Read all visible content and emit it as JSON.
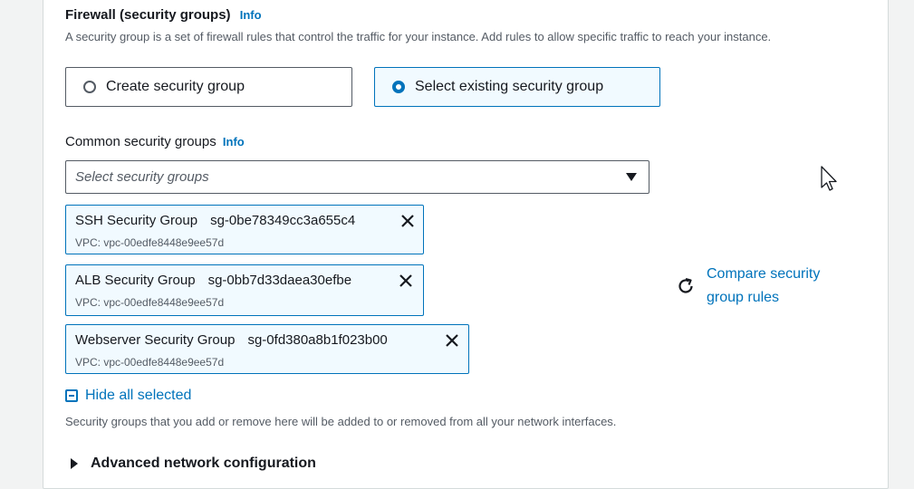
{
  "firewall": {
    "title": "Firewall (security groups)",
    "info": "Info",
    "description": "A security group is a set of firewall rules that control the traffic for your instance. Add rules to allow specific traffic to reach your instance."
  },
  "options": {
    "create_label": "Create security group",
    "existing_label": "Select existing security group",
    "selected": "existing"
  },
  "common_groups": {
    "label": "Common security groups",
    "info": "Info",
    "placeholder": "Select security groups"
  },
  "selected_groups": [
    {
      "name": "SSH Security Group",
      "id": "sg-0be78349cc3a655c4",
      "vpc": "VPC: vpc-00edfe8448e9ee57d"
    },
    {
      "name": "ALB Security Group",
      "id": "sg-0bb7d33daea30efbe",
      "vpc": "VPC: vpc-00edfe8448e9ee57d"
    },
    {
      "name": "Webserver Security Group",
      "id": "sg-0fd380a8b1f023b00",
      "vpc": "VPC: vpc-00edfe8448e9ee57d"
    }
  ],
  "compare": {
    "label": "Compare security group rules"
  },
  "hide_all": {
    "label": "Hide all selected"
  },
  "note": "Security groups that you add or remove here will be added to or removed from all your network interfaces.",
  "advanced": {
    "label": "Advanced network configuration"
  },
  "colors": {
    "link": "#0073bb",
    "selected_bg": "#f1faff"
  }
}
